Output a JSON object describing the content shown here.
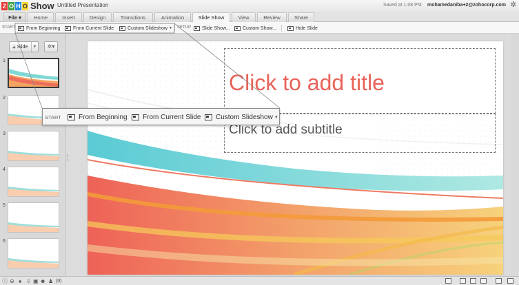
{
  "app": {
    "logo_letters": [
      "Z",
      "O",
      "H",
      "O"
    ],
    "logo_colors": [
      "#e53935",
      "#43a047",
      "#1e88e5",
      "#fdd835"
    ],
    "logo_word": "Show",
    "document_title": "Untitled Presentation",
    "saved_status": "Saved at 1:08 PM",
    "user_email": "mohamedaniba+2@zohocorp.com",
    "settings_icon": "gear-icon"
  },
  "tabs": [
    {
      "label": "File ▾",
      "active": false
    },
    {
      "label": "Home",
      "active": false
    },
    {
      "label": "Insert",
      "active": false
    },
    {
      "label": "Design",
      "active": false
    },
    {
      "label": "Transitions",
      "active": false
    },
    {
      "label": "Animation",
      "active": false
    },
    {
      "label": "Slide Show",
      "active": true
    },
    {
      "label": "View",
      "active": false
    },
    {
      "label": "Review",
      "active": false
    },
    {
      "label": "Share",
      "active": false
    }
  ],
  "ribbon": {
    "start_label": "START",
    "from_beginning": "From Beginning",
    "from_current": "From Current Slide",
    "custom_slideshow": "Custom Slideshow",
    "setup_label": "SETUP",
    "slide_show_setup": "Slide Show...",
    "custom_show": "Custom Show...",
    "hide_slide": "Hide Slide"
  },
  "sidebar": {
    "add_slide_label": "Slide",
    "slide_numbers": [
      "1",
      "2",
      "3",
      "4",
      "5",
      "6"
    ],
    "selected_slide": 1
  },
  "slide": {
    "title_placeholder": "Click to add title",
    "subtitle_placeholder": "Click to add subtitle"
  },
  "popup": {
    "start_label": "START",
    "from_beginning": "From Beginning",
    "from_current": "From Current Slide",
    "custom_slideshow": "Custom Slideshow"
  },
  "status": {
    "chat_count": "(0)"
  },
  "colors": {
    "title_color": "#e8645a",
    "wave_teal": "#6fd3d0",
    "wave_coral": "#ef6a5a",
    "wave_orange": "#f29a3e",
    "wave_yellow": "#f6c85a"
  }
}
